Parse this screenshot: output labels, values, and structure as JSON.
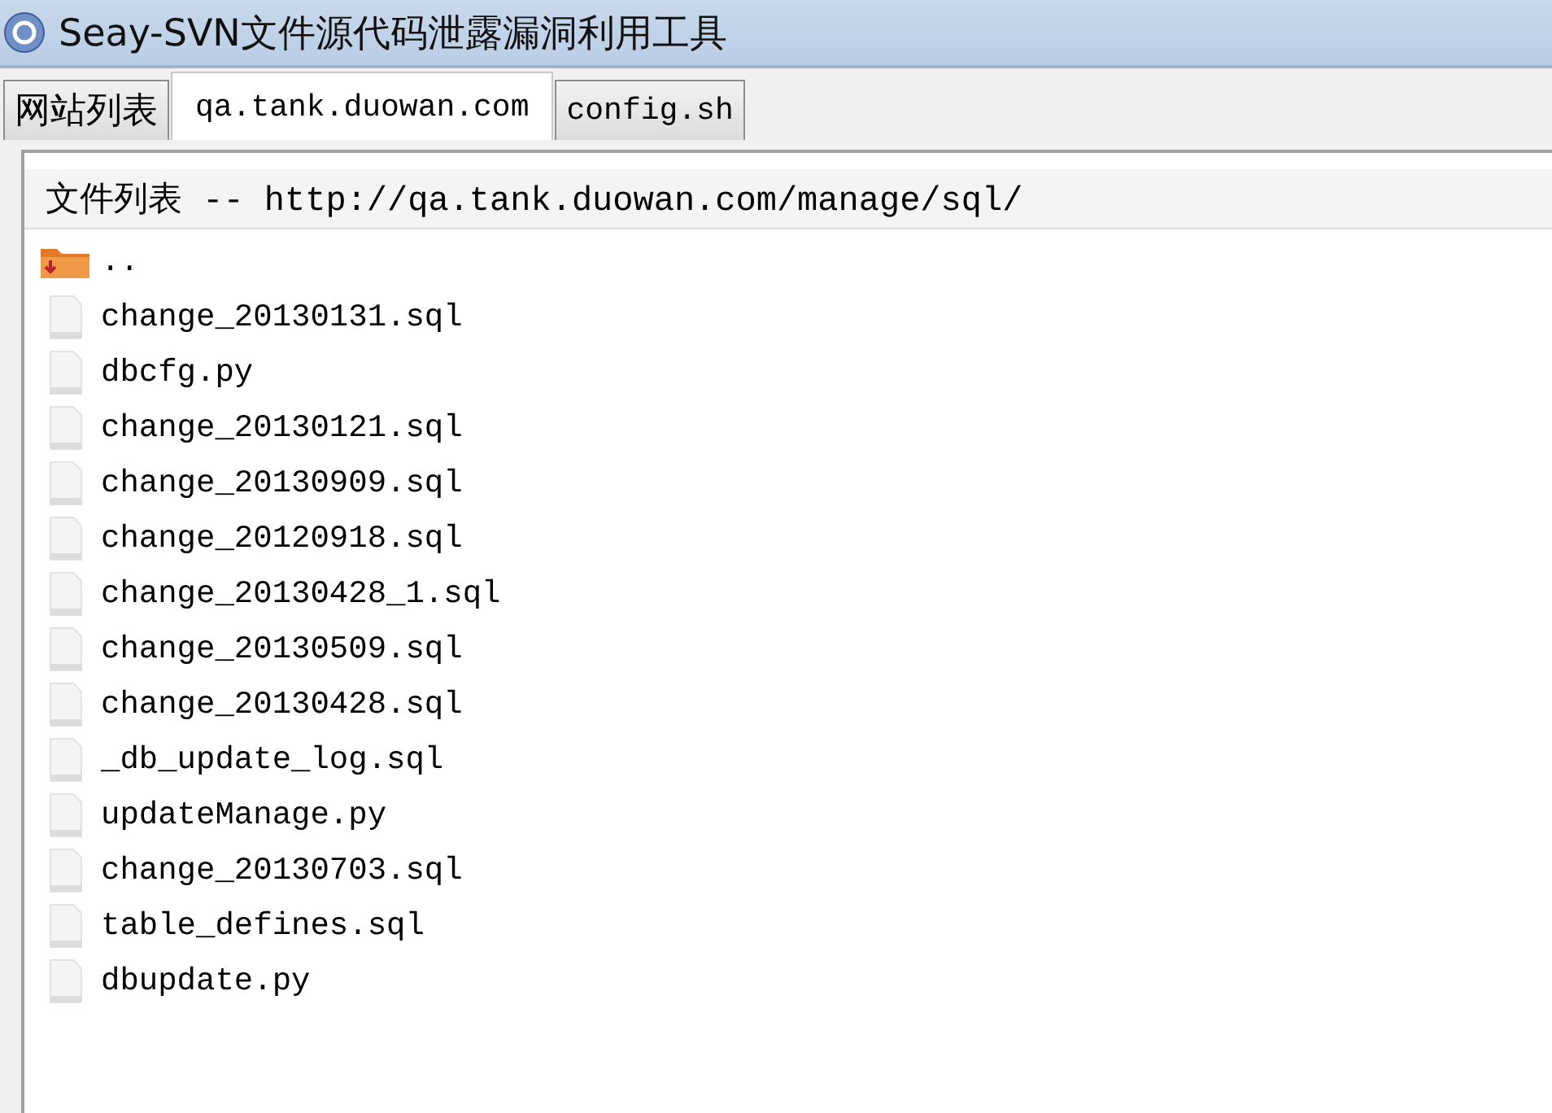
{
  "window": {
    "title": "Seay-SVN文件源代码泄露漏洞利用工具"
  },
  "tabs": [
    {
      "label": "网站列表",
      "selected": false
    },
    {
      "label": "qa.tank.duowan.com",
      "selected": true
    },
    {
      "label": "config.sh",
      "selected": false
    }
  ],
  "file_list": {
    "header": "文件列表 -- http://qa.tank.duowan.com/manage/sql/",
    "items": [
      {
        "kind": "parent",
        "name": ".."
      },
      {
        "kind": "file",
        "name": "change_20130131.sql"
      },
      {
        "kind": "file",
        "name": "dbcfg.py"
      },
      {
        "kind": "file",
        "name": "change_20130121.sql"
      },
      {
        "kind": "file",
        "name": "change_20130909.sql"
      },
      {
        "kind": "file",
        "name": "change_20120918.sql"
      },
      {
        "kind": "file",
        "name": "change_20130428_1.sql"
      },
      {
        "kind": "file",
        "name": "change_20130509.sql"
      },
      {
        "kind": "file",
        "name": "change_20130428.sql"
      },
      {
        "kind": "file",
        "name": "_db_update_log.sql"
      },
      {
        "kind": "file",
        "name": "updateManage.py"
      },
      {
        "kind": "file",
        "name": "change_20130703.sql"
      },
      {
        "kind": "file",
        "name": "table_defines.sql"
      },
      {
        "kind": "file",
        "name": "dbupdate.py"
      }
    ]
  }
}
